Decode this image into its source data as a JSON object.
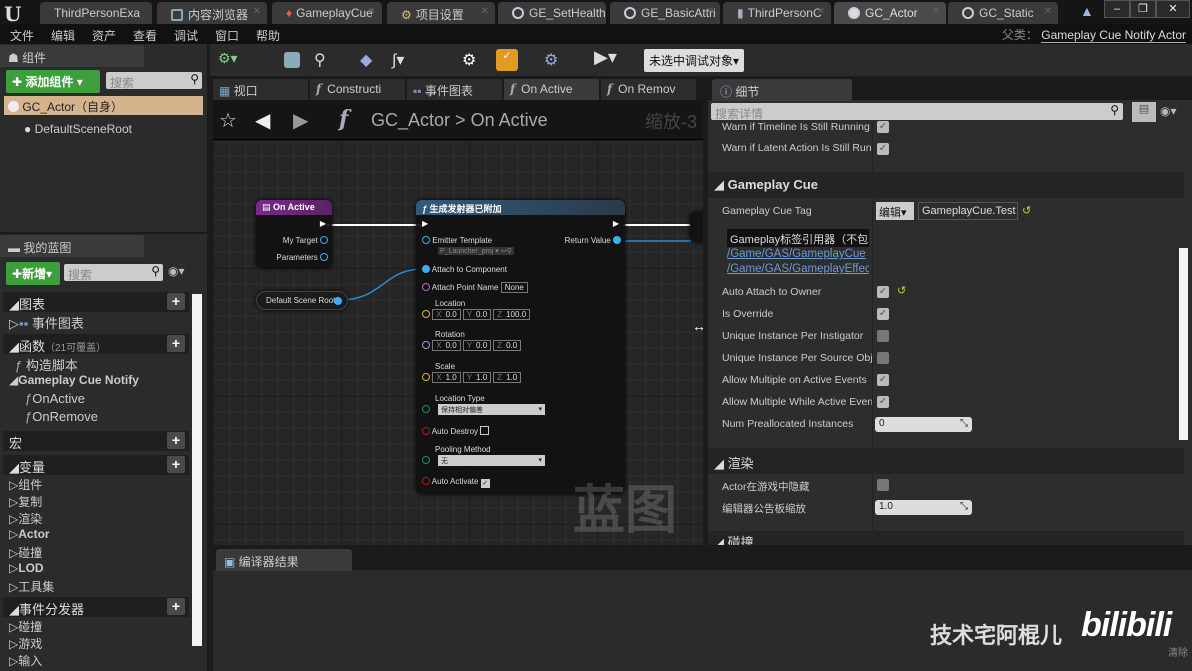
{
  "window": {
    "tabs": [
      "ThirdPersonExa",
      "内容浏览器",
      "GameplayCue",
      "项目设置",
      "GE_SetHealth",
      "GE_BasicAttri",
      "ThirdPersonC",
      "GC_Actor",
      "GC_Static"
    ],
    "active_tab": "GC_Actor",
    "controls": [
      "–",
      "❐",
      "✕"
    ]
  },
  "menu": [
    "文件",
    "编辑",
    "资产",
    "查看",
    "调试",
    "窗口",
    "帮助"
  ],
  "parent_class": {
    "label": "父类：",
    "value": "Gameplay Cue Notify Actor"
  },
  "toolbar": {
    "debug_target": "未选中调试对象▾"
  },
  "components": {
    "tab": "组件",
    "add_button": "添加组件",
    "search_placeholder": "搜索",
    "items": [
      "GC_Actor（自身）",
      "DefaultSceneRoot"
    ]
  },
  "my_blueprint": {
    "tab": "我的蓝图",
    "new_button": "新增",
    "search_placeholder": "搜索",
    "graphs": "图表",
    "event_graph": "事件图表",
    "functions": "函数",
    "functions_note": "（21可覆盖）",
    "construct": "构造脚本",
    "gc_notify": "Gameplay Cue Notify",
    "on_active": "OnActive",
    "on_remove": "OnRemove",
    "macros": "宏",
    "variables": "变量",
    "var_items": [
      "组件",
      "复制",
      "渲染",
      "Actor",
      "碰撞",
      "LOD",
      "工具集"
    ],
    "dispatchers": "事件分发器",
    "disp_items": [
      "碰撞",
      "游戏",
      "输入"
    ]
  },
  "graph_tabs": [
    "视口",
    "Constructi",
    "事件图表",
    "On Active",
    "On Remov"
  ],
  "breadcrumb": {
    "root": "GC_Actor",
    "sep": ">",
    "current": "On Active",
    "zoom": "缩放-3"
  },
  "graph": {
    "watermark": "蓝图",
    "event_node": {
      "title": "On Active",
      "pins": [
        "My Target",
        "Parameters"
      ]
    },
    "scene_root": "Default Scene Root",
    "func_node": {
      "title": "生成发射器已附加",
      "emitter_template": "Emitter Template",
      "emitter_value": "P_Launcher_proj",
      "return_value": "Return Value",
      "attach_to": "Attach to Component",
      "attach_point": "Attach Point Name",
      "attach_point_value": "None",
      "location": "Location",
      "location_vals": [
        "0.0",
        "0.0",
        "100.0"
      ],
      "rotation": "Rotation",
      "rotation_vals": [
        "0.0",
        "0.0",
        "0.0"
      ],
      "scale": "Scale",
      "scale_vals": [
        "1.0",
        "1.0",
        "1.0"
      ],
      "axes": [
        "X",
        "Y",
        "Z"
      ],
      "location_type": "Location Type",
      "location_type_value": "保持相对偏差",
      "auto_destroy": "Auto Destroy",
      "pooling": "Pooling Method",
      "pooling_value": "无",
      "auto_activate": "Auto Activate"
    }
  },
  "details": {
    "tab": "细节",
    "search_placeholder": "搜索详情",
    "rows_top": [
      {
        "label": "Warn if Timeline Is Still Running",
        "checked": true
      },
      {
        "label": "Warn if Latent Action Is Still Running",
        "checked": true
      }
    ],
    "gameplay_cue": "Gameplay Cue",
    "cue_tag_label": "Gameplay Cue Tag",
    "edit_button": "编辑▾",
    "cue_tag_value": "GameplayCue.Test",
    "referencer_title": "Gameplay标签引用器（不包",
    "referencer_links": [
      "/Game/GAS/GameplayCue",
      "/Game/GAS/GameplayEffect"
    ],
    "rows": [
      {
        "label": "Auto Attach to Owner",
        "checked": true
      },
      {
        "label": "Is Override",
        "checked": true
      },
      {
        "label": "Unique Instance Per Instigator",
        "checked": false
      },
      {
        "label": "Unique Instance Per Source Object",
        "checked": false
      },
      {
        "label": "Allow Multiple on Active Events",
        "checked": true
      },
      {
        "label": "Allow Multiple While Active Events",
        "checked": true
      }
    ],
    "num_prealloc_label": "Num Preallocated Instances",
    "num_prealloc_value": "0",
    "render": "渲染",
    "hidden_label": "Actor在游戏中隐藏",
    "billboard_label": "编辑器公告板缩放",
    "billboard_value": "1.0",
    "collision": "碰撞"
  },
  "compiler": {
    "tab": "编译器结果"
  },
  "overlay": {
    "channel": "技术宅阿棍儿",
    "brand": "bilibili",
    "clear": "清除"
  }
}
